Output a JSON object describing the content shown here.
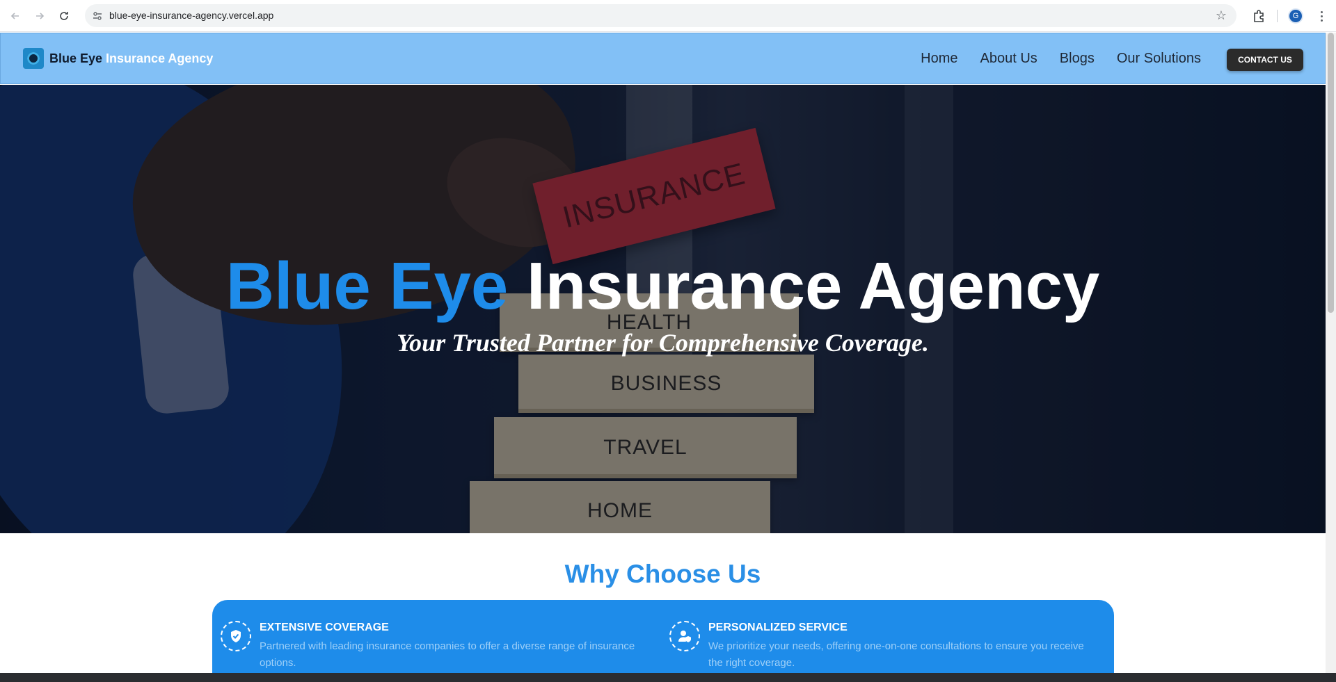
{
  "browser": {
    "url": "blue-eye-insurance-agency.vercel.app",
    "profile_initial": "G"
  },
  "header": {
    "brand_dark": "Blue Eye",
    "brand_light": " Insurance Agency",
    "nav": [
      "Home",
      "About Us",
      "Blogs",
      "Our Solutions"
    ],
    "contact_label": "CONTACT US"
  },
  "hero": {
    "title_blue": "Blue Eye",
    "title_white": " Insurance Agency",
    "subtitle": "Your Trusted Partner for Comprehensive Coverage.",
    "image_blocks": [
      "INSURANCE",
      "HEALTH",
      "BUSINESS",
      "TRAVEL",
      "HOME"
    ]
  },
  "why": {
    "title": "Why Choose Us",
    "features": [
      {
        "title": "EXTENSIVE COVERAGE",
        "desc": "Partnered with leading insurance companies to offer a diverse range of insurance options.",
        "icon": "shield-check-icon"
      },
      {
        "title": "PERSONALIZED SERVICE",
        "desc": "We prioritize your needs, offering one-on-one consultations to ensure you receive the right coverage.",
        "icon": "user-shield-icon"
      }
    ]
  },
  "colors": {
    "header_bg": "#82c0f6",
    "accent_blue": "#1e8cea",
    "contact_bg": "#2b2b2b"
  }
}
